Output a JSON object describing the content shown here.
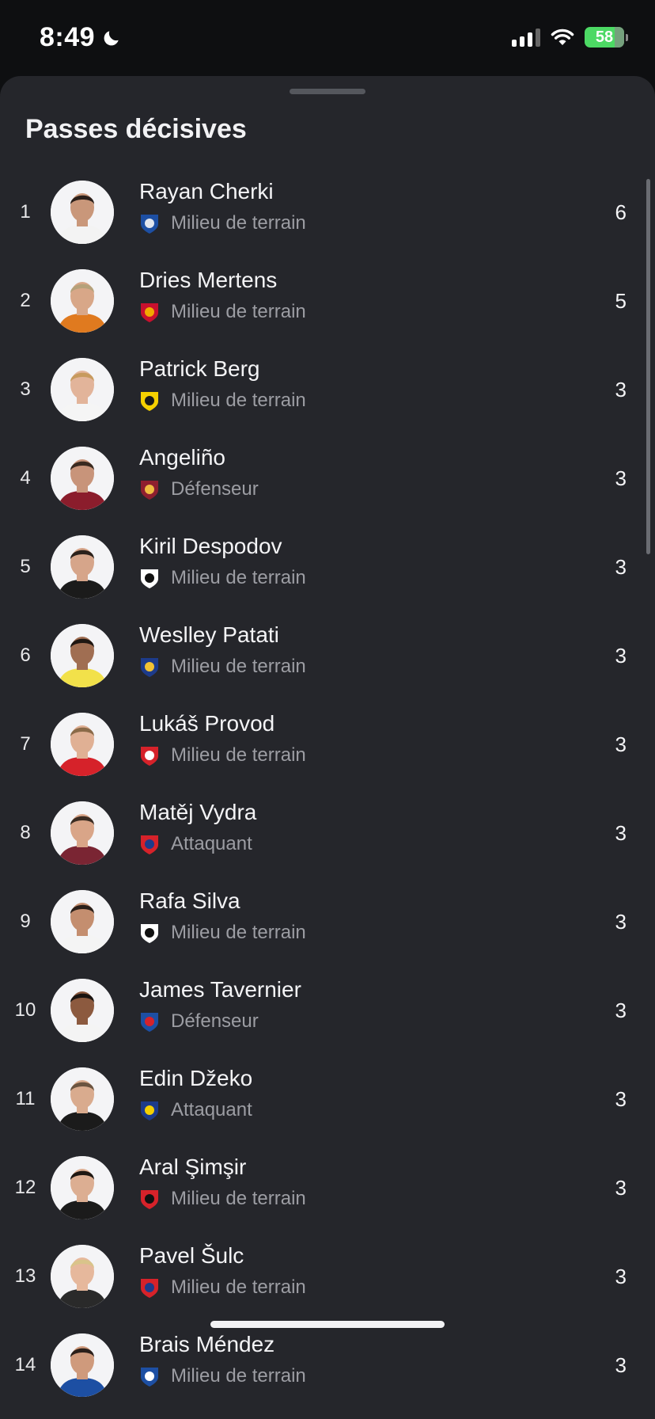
{
  "status_bar": {
    "time": "8:49",
    "battery": "58"
  },
  "sheet": {
    "title": "Passes décisives"
  },
  "players": [
    {
      "rank": "1",
      "name": "Rayan Cherki",
      "position": "Milieu de terrain",
      "value": "6",
      "skin": "#c9977a",
      "hair": "#2a1f1a",
      "shirt": "#f3f3f3",
      "crest": [
        "#1d4fa3",
        "#e2e6ee"
      ]
    },
    {
      "rank": "2",
      "name": "Dries Mertens",
      "position": "Milieu de terrain",
      "value": "5",
      "skin": "#d8a788",
      "hair": "#b5a17a",
      "shirt": "#e07a1f",
      "crest": [
        "#c8102e",
        "#f2a900"
      ]
    },
    {
      "rank": "3",
      "name": "Patrick Berg",
      "position": "Milieu de terrain",
      "value": "3",
      "skin": "#e2b49a",
      "hair": "#c79a5e",
      "shirt": "#f5f5f5",
      "crest": [
        "#f5d000",
        "#1a1a1a"
      ]
    },
    {
      "rank": "4",
      "name": "Angeliño",
      "position": "Défenseur",
      "value": "3",
      "skin": "#c8947a",
      "hair": "#3a2a20",
      "shirt": "#8b1d2c",
      "crest": [
        "#8e1f2f",
        "#f0bc42"
      ]
    },
    {
      "rank": "5",
      "name": "Kiril Despodov",
      "position": "Milieu de terrain",
      "value": "3",
      "skin": "#d6a58a",
      "hair": "#2b211b",
      "shirt": "#1b1b1b",
      "crest": [
        "#ffffff",
        "#111111"
      ]
    },
    {
      "rank": "6",
      "name": "Weslley Patati",
      "position": "Milieu de terrain",
      "value": "3",
      "skin": "#a06e52",
      "hair": "#1f1712",
      "shirt": "#f2e14a",
      "crest": [
        "#1d3b8a",
        "#f2c233"
      ]
    },
    {
      "rank": "7",
      "name": "Lukáš Provod",
      "position": "Milieu de terrain",
      "value": "3",
      "skin": "#e0b094",
      "hair": "#8a6a48",
      "shirt": "#d6222a",
      "crest": [
        "#d6222a",
        "#ffffff"
      ]
    },
    {
      "rank": "8",
      "name": "Matěj Vydra",
      "position": "Attaquant",
      "value": "3",
      "skin": "#d9a588",
      "hair": "#3b2c22",
      "shirt": "#7a2533",
      "crest": [
        "#d6222a",
        "#1d3b8a"
      ]
    },
    {
      "rank": "9",
      "name": "Rafa Silva",
      "position": "Milieu de terrain",
      "value": "3",
      "skin": "#c48e6f",
      "hair": "#2a1f19",
      "shirt": "#f4f4f4",
      "crest": [
        "#ffffff",
        "#111111"
      ]
    },
    {
      "rank": "10",
      "name": "James Tavernier",
      "position": "Défenseur",
      "value": "3",
      "skin": "#8c5a3f",
      "hair": "#1a1411",
      "shirt": "#f4f4f4",
      "crest": [
        "#1d4fa3",
        "#d6222a"
      ]
    },
    {
      "rank": "11",
      "name": "Edin Džeko",
      "position": "Attaquant",
      "value": "3",
      "skin": "#d9ab8e",
      "hair": "#6b5440",
      "shirt": "#1b1b1b",
      "crest": [
        "#1d3b8a",
        "#f5d000"
      ]
    },
    {
      "rank": "12",
      "name": "Aral Şimşir",
      "position": "Milieu de terrain",
      "value": "3",
      "skin": "#dcae92",
      "hair": "#1e1712",
      "shirt": "#1b1b1b",
      "crest": [
        "#d6222a",
        "#111111"
      ]
    },
    {
      "rank": "13",
      "name": "Pavel Šulc",
      "position": "Milieu de terrain",
      "value": "3",
      "skin": "#e6b89c",
      "hair": "#d9c48a",
      "shirt": "#2a2a2a",
      "crest": [
        "#d6222a",
        "#1d3b8a"
      ]
    },
    {
      "rank": "14",
      "name": "Brais Méndez",
      "position": "Milieu de terrain",
      "value": "3",
      "skin": "#cf9a7c",
      "hair": "#2a1f1a",
      "shirt": "#1d4fa3",
      "crest": [
        "#1d4fa3",
        "#ffffff"
      ]
    }
  ]
}
